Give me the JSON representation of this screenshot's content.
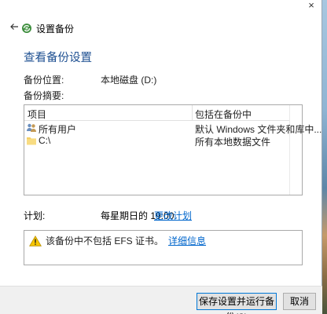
{
  "window": {
    "title": "设置备份",
    "close_glyph": "×"
  },
  "main": {
    "heading": "查看备份设置",
    "location_label": "备份位置:",
    "location_value": "本地磁盘 (D:)",
    "summary_label": "备份摘要:"
  },
  "table": {
    "headers": [
      "项目",
      "包括在备份中"
    ],
    "rows": [
      {
        "icon": "users-icon",
        "item": "所有用户",
        "included": "默认 Windows 文件夹和库中..."
      },
      {
        "icon": "folder-icon",
        "item": "C:\\",
        "included": "所有本地数据文件"
      }
    ]
  },
  "schedule": {
    "label": "计划:",
    "value": "每星期日的 19:00",
    "change_link": "更改计划"
  },
  "warning": {
    "icon": "warning-icon",
    "text": "该备份中不包括 EFS 证书。",
    "details_link": "详细信息"
  },
  "footer": {
    "save_run_label": "保存设置并运行备份(S)",
    "cancel_label": "取消"
  },
  "colors": {
    "heading": "#1d4f91",
    "link": "#0066cc",
    "primary_border": "#0078d7"
  }
}
